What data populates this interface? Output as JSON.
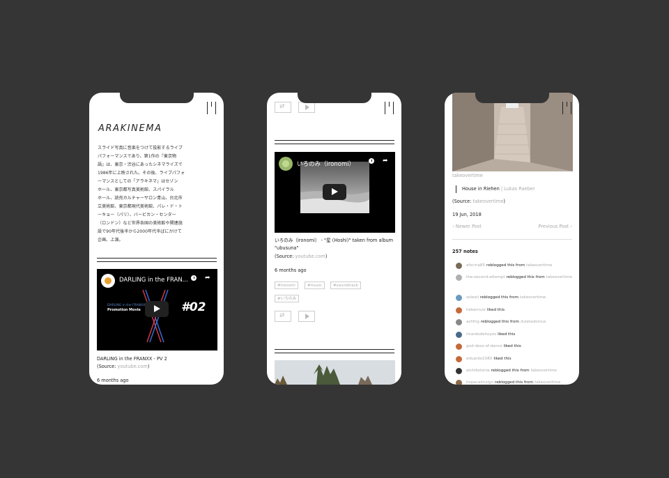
{
  "colors": {
    "background": "#353535",
    "phone": "#ffffff",
    "text": "#222222",
    "muted": "#aaaaaa",
    "video_bg": "#000000"
  },
  "phone1": {
    "title": "ARAKINEMA",
    "description": "スライド写真に音楽をつけて投影するライブ\nパフォーマンスであり、第1作の『東京物\n語』は、東京・渋谷にあったシネマライズで\n1986年に上映された。その後、ライブパフォ\nーマンスとしての「アラキネマ」はセゾン\nホール、東京都写真美術館、スパイラル\nホール、読売カルチャーサロン青山、台北市\n立美術館、東京都現代美術館、パレ・ド・ト\nーキョー（パリ）、バービカン・センター\n（ロンドン）など世界各国の美術館や関連施\n設で90年代後半から2000年代半ばにかけて\n企画、上演。",
    "video": {
      "title": "DARLING in the FRANXX - PV 2",
      "title_short": "DARLING in the FRAN...",
      "overlay_number": "#02",
      "promo_line1": "DARLING in the FRANXX",
      "promo_line2": "Promotion Movie"
    },
    "caption": "DARLING in the FRANXX - PV 2",
    "source_label": "(Source: ",
    "source_link": "youtube.com",
    "source_close": ")",
    "time_ago": "6 months ago"
  },
  "phone2": {
    "video": {
      "title": "いろのみ（ironomi）"
    },
    "caption": "いろのみ（ironomi） - \"星 (Hoshi)\" taken from album \"ubusuna\"",
    "source_label": "(Source: ",
    "source_link": "youtube.com",
    "source_close": ")",
    "time_ago": "6 months ago",
    "tags": [
      "#ironomi",
      "#music",
      "#soundtrack",
      "#いろのみ"
    ]
  },
  "phone3": {
    "username": "takeovertime",
    "post_title": "House in Riehen",
    "post_separator": " | ",
    "post_author": "Lukas Raeber",
    "source_label": "(Source: ",
    "source_link": "takeovertime",
    "source_close": ")",
    "date": "19 Jun, 2018",
    "newer_post": "‹  Newer Post",
    "previous_post": "Previous Post  ›",
    "notes_count": "257 notes",
    "notes": [
      {
        "user": "afscina85",
        "action": "reblogged this from",
        "target": "takeovertime",
        "avatar_color": "#7a6a5a"
      },
      {
        "user": "the-second-attempt",
        "action": "reblogged this from",
        "target": "takeovertime",
        "avatar_color": "#b0b0b0"
      },
      {
        "user": "solesti",
        "action": "reblogged this from",
        "target": "takeovertime",
        "avatar_color": "#6a9abf"
      },
      {
        "user": "hebenrulz",
        "action": "liked this",
        "target": "",
        "avatar_color": "#c46a3a"
      },
      {
        "user": "ashfng",
        "action": "reblogged this from",
        "target": "duletadomus",
        "avatar_color": "#888888"
      },
      {
        "user": "ricardodehoyos",
        "action": "liked this",
        "target": "",
        "avatar_color": "#4a6a8a"
      },
      {
        "user": "god-dess-of-dance",
        "action": "liked this",
        "target": "",
        "avatar_color": "#c46a3a"
      },
      {
        "user": "eduardo1080",
        "action": "liked this",
        "target": "",
        "avatar_color": "#c46a3a"
      },
      {
        "user": "atchitetonia",
        "action": "reblogged this from",
        "target": "takeovertime",
        "avatar_color": "#333333"
      },
      {
        "user": "hopecalmsign",
        "action": "reblogged this from",
        "target": "takeovertime",
        "avatar_color": "#8a6a4a"
      }
    ]
  }
}
